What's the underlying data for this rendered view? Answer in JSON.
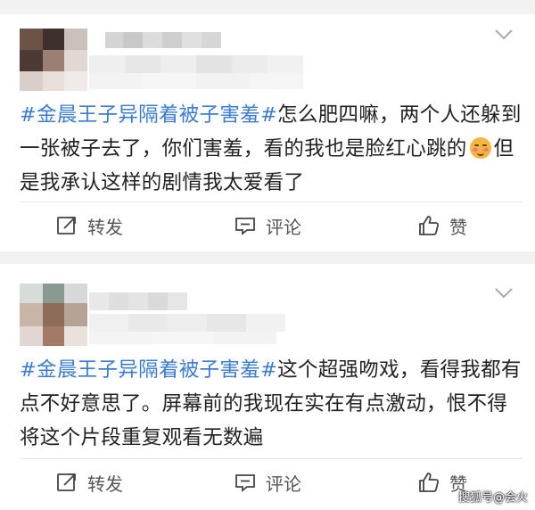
{
  "colors": {
    "hashtag": "#3b7ccf",
    "text": "#222222",
    "action_text": "#555555",
    "background": "#f2f2f2",
    "card": "#ffffff"
  },
  "posts": [
    {
      "hashtag": "#金晨王子异隔着被子害羞#",
      "text_before_emoji": "怎么肥四嘛，两个人还躲到一张被子去了，你们害羞，看的我也是脸红心跳的",
      "emoji": "blush-emoji",
      "text_after_emoji": "但是我承认这样的剧情我太爱看了",
      "actions": {
        "repost": "转发",
        "comment": "评论",
        "like": "赞"
      }
    },
    {
      "hashtag": "#金晨王子异隔着被子害羞#",
      "text": "这个超强吻戏，看得我都有点不好意思了。屏幕前的我现在实在有点激动，恨不得将这个片段重复观看无数遍",
      "actions": {
        "repost": "转发",
        "comment": "评论",
        "like": "赞"
      }
    }
  ],
  "watermark": "搜狐号@会火"
}
